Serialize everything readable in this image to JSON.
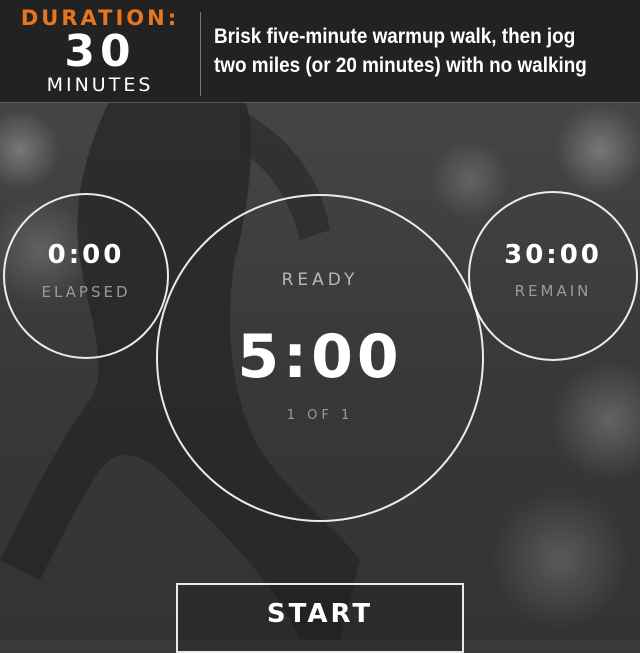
{
  "header": {
    "duration_label": "DURATION:",
    "duration_value": "30",
    "duration_unit": "MINUTES",
    "description": "Brisk five-minute warmup walk, then jog two miles (or 20 minutes) with no walking"
  },
  "timer": {
    "elapsed_value": "0:00",
    "elapsed_label": "ELAPSED",
    "remain_value": "30:00",
    "remain_label": "REMAIN",
    "status": "READY",
    "interval_time": "5:00",
    "interval_count": "1 OF 1"
  },
  "actions": {
    "start_label": "START"
  },
  "colors": {
    "accent": "#e8761f"
  }
}
